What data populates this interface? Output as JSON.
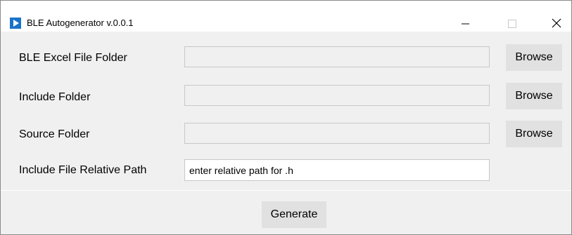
{
  "window": {
    "title": "BLE Autogenerator v.0.0.1",
    "app_icon": "play-triangle-icon",
    "controls": {
      "minimize_icon": "minimize-icon",
      "maximize_icon": "maximize-icon",
      "close_icon": "close-icon"
    }
  },
  "form": {
    "rows": [
      {
        "label": "BLE Excel File Folder",
        "value": "",
        "button": "Browse"
      },
      {
        "label": "Include Folder",
        "value": "",
        "button": "Browse"
      },
      {
        "label": "Source Folder",
        "value": "",
        "button": "Browse"
      },
      {
        "label": "Include File Relative Path",
        "placeholder": "enter relative path for .h"
      }
    ]
  },
  "footer": {
    "generate_label": "Generate"
  },
  "colors": {
    "accent": "#1a73c9",
    "window_bg": "#f0f0f0",
    "button_bg": "#e1e1e1",
    "titlebar_bg": "#ffffff"
  }
}
